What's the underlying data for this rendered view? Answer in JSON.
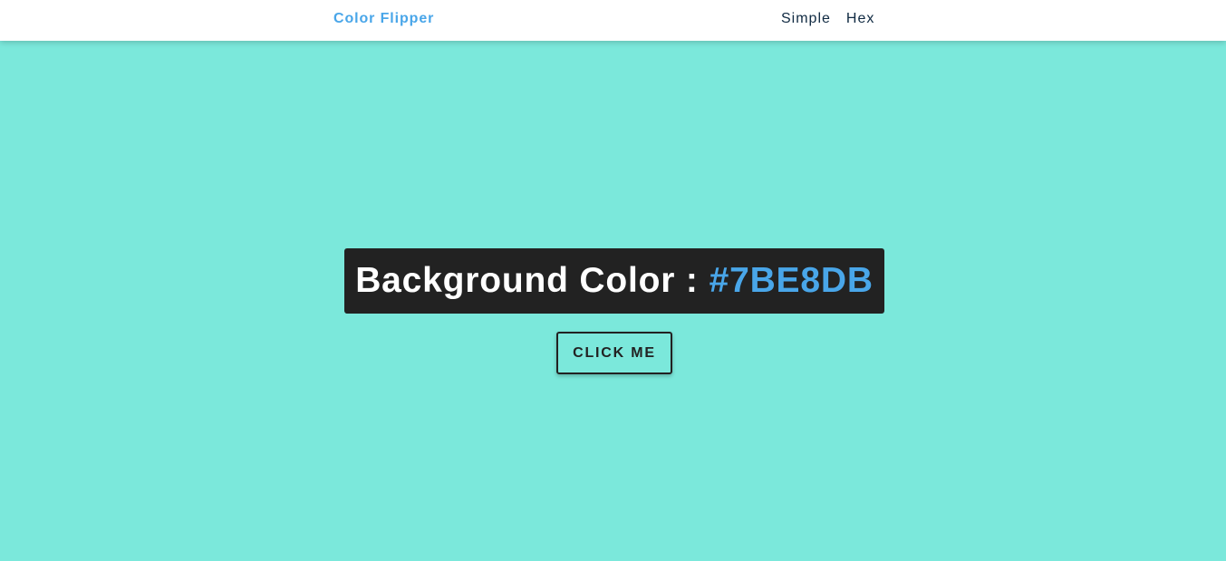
{
  "navbar": {
    "brand": "Color Flipper",
    "links": [
      {
        "label": "Simple"
      },
      {
        "label": "Hex"
      }
    ]
  },
  "main": {
    "color_label": "Background Color :",
    "color_value": "#7BE8DB",
    "button_label": "CLICK ME"
  },
  "colors": {
    "background": "#7BE8DB",
    "accent": "#49A6E9",
    "box": "#222222",
    "nav_text": "#102A42"
  }
}
